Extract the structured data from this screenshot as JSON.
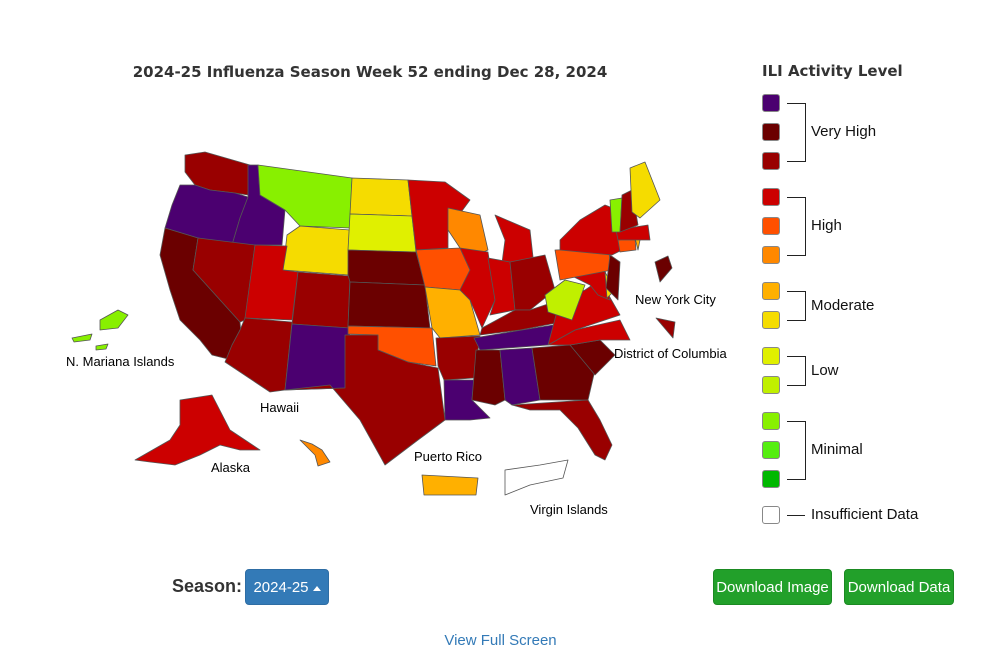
{
  "title": "2024-25 Influenza Season Week 52 ending Dec 28, 2024",
  "colors": {
    "vh3": "#4b0070",
    "vh2": "#6b0000",
    "vh1": "#990000",
    "h3": "#cc0000",
    "h2": "#ff5000",
    "h1": "#ff8800",
    "m2": "#ffb000",
    "m1": "#f5dc00",
    "l2": "#e0f000",
    "l1": "#c0f000",
    "min3": "#88f000",
    "min2": "#55ee10",
    "min1": "#00b800",
    "insufficient": "#ffffff"
  },
  "legend": {
    "title": "ILI Activity Level",
    "groups": [
      {
        "label": "Very High",
        "levels": [
          "vh3",
          "vh2",
          "vh1"
        ]
      },
      {
        "label": "High",
        "levels": [
          "h3",
          "h2",
          "h1"
        ]
      },
      {
        "label": "Moderate",
        "levels": [
          "m2",
          "m1"
        ]
      },
      {
        "label": "Low",
        "levels": [
          "l2",
          "l1"
        ]
      },
      {
        "label": "Minimal",
        "levels": [
          "min3",
          "min2",
          "min1"
        ]
      },
      {
        "label": "Insufficient Data",
        "levels": [
          "insufficient"
        ]
      }
    ]
  },
  "map_labels": {
    "nmi": "N. Mariana Islands",
    "hawaii": "Hawaii",
    "alaska": "Alaska",
    "puerto_rico": "Puerto Rico",
    "virgin_islands": "Virgin Islands",
    "nyc": "New York City",
    "dc": "District of Columbia"
  },
  "states": {
    "WA": "vh1",
    "OR": "vh3",
    "CA": "vh2",
    "ID": "vh3",
    "NV": "vh1",
    "MT": "min3",
    "WY": "m1",
    "UT": "h3",
    "AZ": "vh1",
    "CO": "vh1",
    "NM": "vh3",
    "ND": "m1",
    "SD": "l2",
    "NE": "vh2",
    "KS": "vh2",
    "OK": "h2",
    "TX": "vh1",
    "MN": "h3",
    "IA": "h2",
    "MO": "m2",
    "AR": "vh1",
    "LA": "vh3",
    "WI": "h1",
    "IL": "h3",
    "MI": "h3",
    "IN": "h3",
    "OH": "vh1",
    "KY": "vh1",
    "TN": "vh3",
    "MS": "vh2",
    "AL": "vh3",
    "GA": "vh2",
    "FL": "vh1",
    "SC": "vh2",
    "NC": "h3",
    "VA": "h3",
    "WV": "l1",
    "MD": "h3",
    "DE": "m1",
    "PA": "h2",
    "NJ": "vh2",
    "NY": "h3",
    "CT": "h2",
    "RI": "m2",
    "MA": "h3",
    "VT": "min3",
    "NH": "vh1",
    "ME": "m1",
    "AK": "h3",
    "HI": "h1",
    "PR": "m2",
    "VI": "insufficient",
    "NMI": "min3",
    "NYC": "vh2",
    "DC": "vh1"
  },
  "controls": {
    "season_label": "Season:",
    "season_value": "2024-25",
    "download_image": "Download Image",
    "download_data": "Download Data",
    "view_full_screen": "View Full Screen"
  }
}
